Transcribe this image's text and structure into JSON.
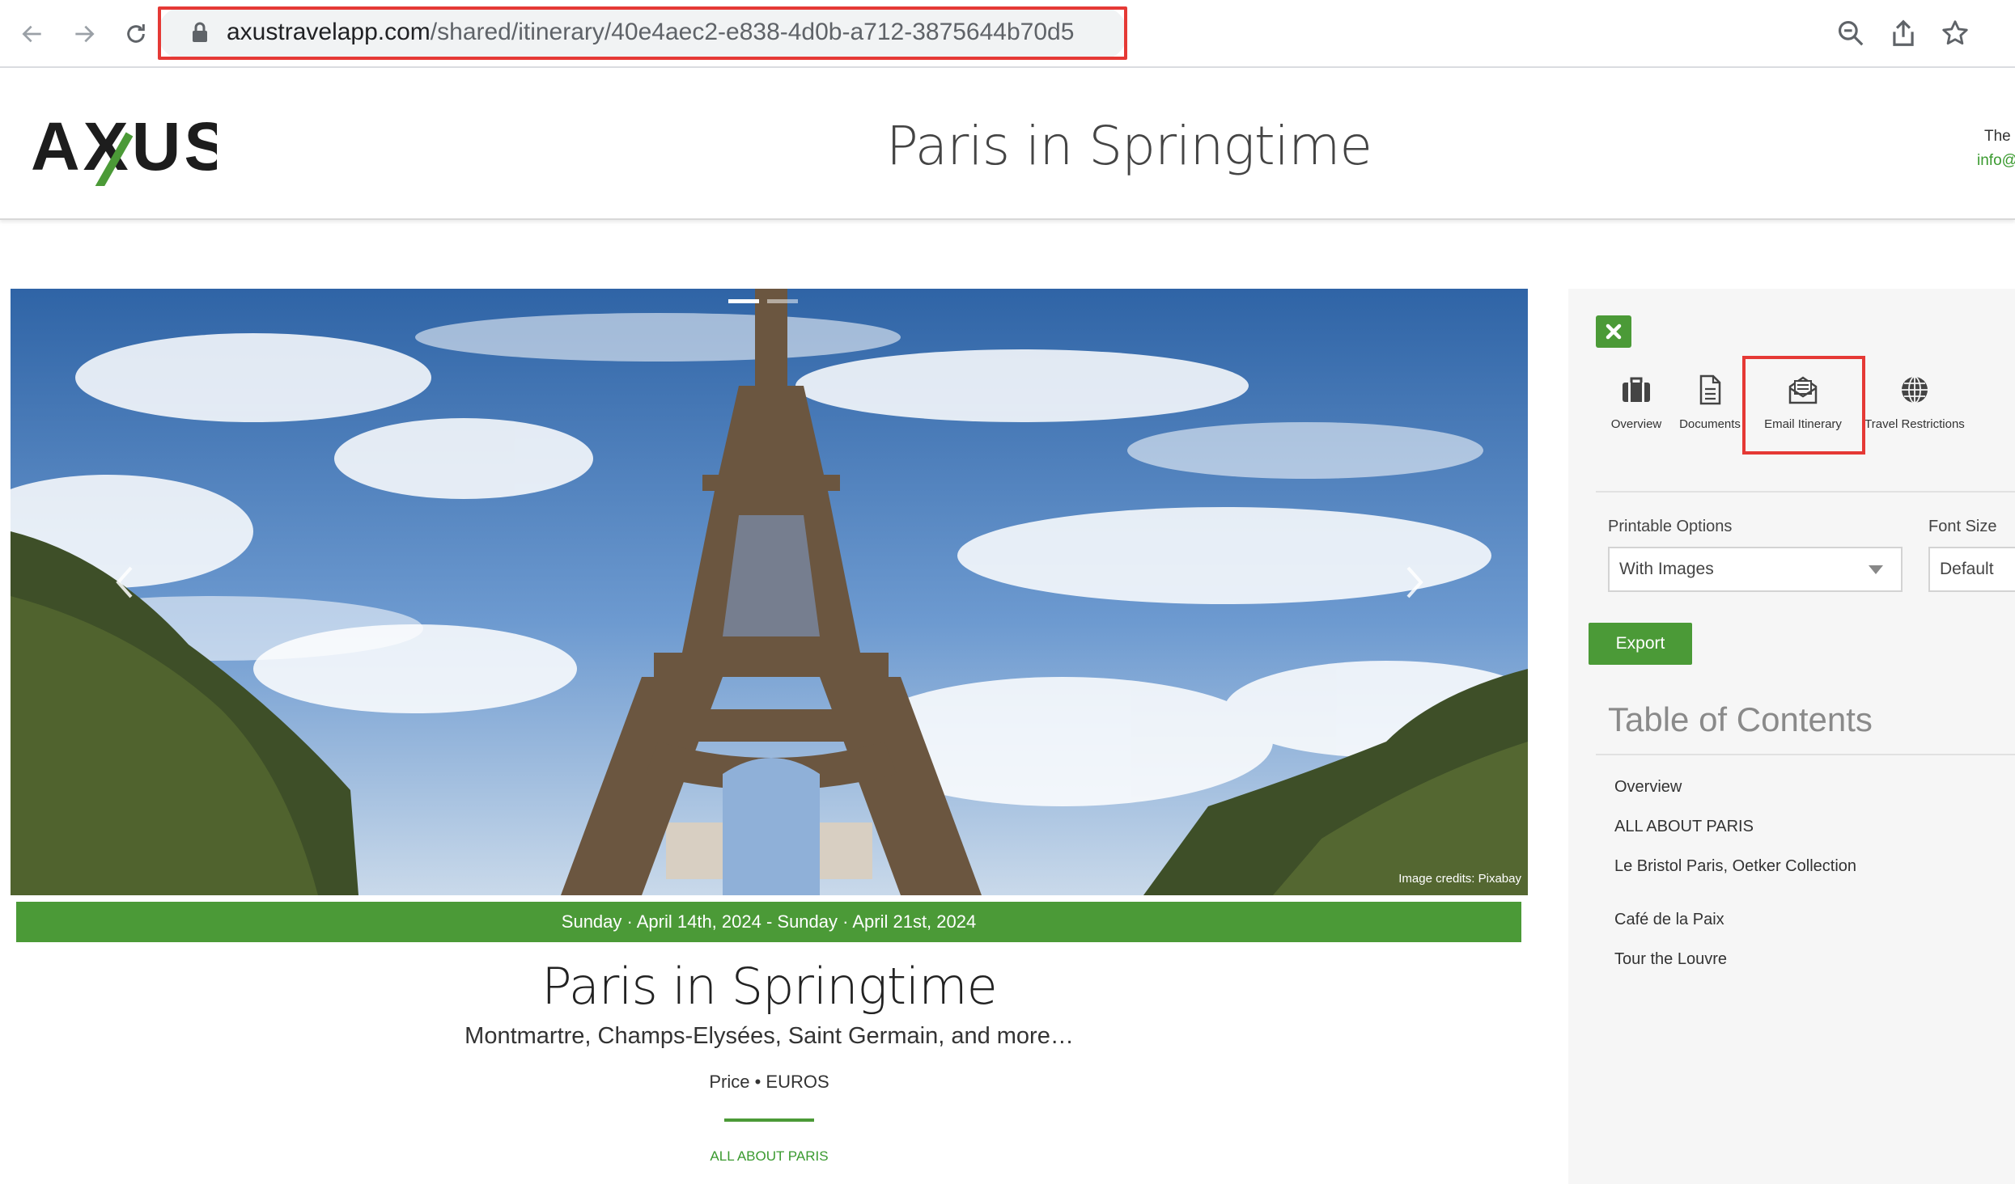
{
  "browser": {
    "url_host": "axustravelapp.com",
    "url_path": "/shared/itinerary/40e4aec2-e838-4d0b-a712-3875644b70d5",
    "icons": [
      "back-icon",
      "forward-icon",
      "reload-icon",
      "lock-icon",
      "zoom-icon",
      "share-icon",
      "bookmark-star-icon"
    ]
  },
  "header": {
    "logo_text": "AXUS",
    "title": "Paris in Springtime",
    "agency_fragment": "The",
    "email_fragment": "info@"
  },
  "hero": {
    "image_credit": "Image credits: Pixabay",
    "date_range": "Sunday · April 14th, 2024 - Sunday · April 21st, 2024",
    "title": "Paris in Springtime",
    "subtitle": "Montmartre, Champs-Elysées, Saint Germain, and more…",
    "price": "Price • EUROS",
    "section_link": "ALL ABOUT PARIS"
  },
  "sidebar": {
    "tools": [
      {
        "label": "Overview",
        "icon": "briefcase-icon"
      },
      {
        "label": "Documents",
        "icon": "document-icon"
      },
      {
        "label": "Email Itinerary",
        "icon": "email-itinerary-icon"
      },
      {
        "label": "Travel Restrictions",
        "icon": "globe-icon"
      }
    ],
    "printable_options_label": "Printable Options",
    "printable_options_value": "With Images",
    "font_size_label": "Font Size",
    "font_size_value": "Default",
    "export_label": "Export",
    "toc_title": "Table of Contents",
    "toc_items": [
      "Overview",
      "ALL ABOUT PARIS",
      "Le Bristol Paris, Oetker Collection",
      "Café de la Paix",
      "Tour the Louvre"
    ]
  },
  "colors": {
    "brand_green": "#4b9a37",
    "highlight_red": "#e53935"
  }
}
